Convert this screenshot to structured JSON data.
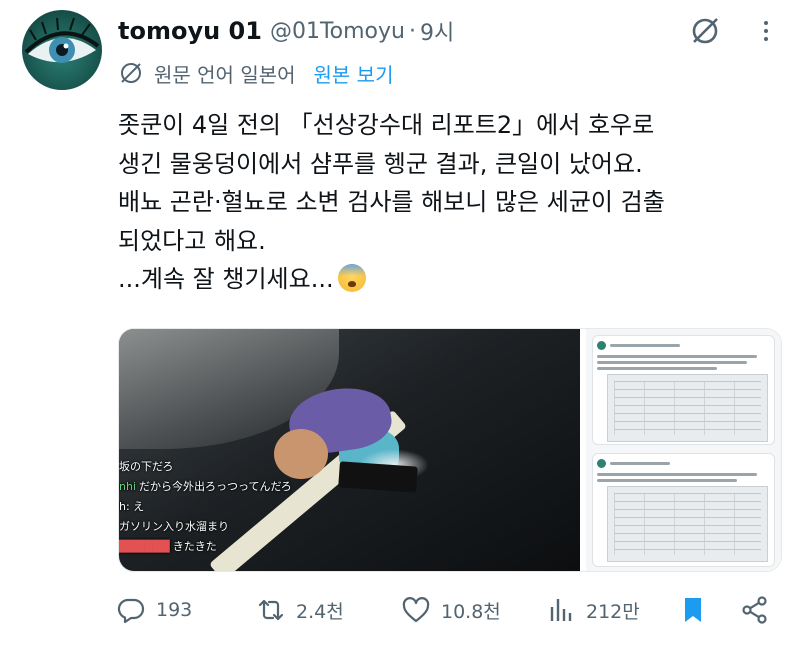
{
  "author": {
    "display_name": "tomoyu 01",
    "handle": "@01Tomoyu",
    "separator": "·",
    "time": "9시"
  },
  "translation": {
    "language_label": "원문 언어 일본어",
    "show_original_label": "원본 보기"
  },
  "tweet": {
    "lines": [
      "좃쿤이 4일 전의 「선상강수대 리포트2」에서 호우로",
      "생긴 물웅덩이에서 샴푸를 헹군 결과, 큰일이 났어요.",
      "배뇨 곤란·혈뇨로 소변 검사를 해보니 많은 세균이 검출",
      "되었다고 해요.",
      "...계속 잘 챙기세요..."
    ]
  },
  "media": {
    "chat_lines": [
      {
        "user": "",
        "text": "坂の下だろ"
      },
      {
        "user": "nhi",
        "text": "だから今外出ろっつってんだろ"
      },
      {
        "user": "",
        "text": "h: え"
      },
      {
        "user": "",
        "text": "ガソリン入り水溜まり"
      },
      {
        "user": "",
        "text": ""
      },
      {
        "user": "",
        "text": "きたきた"
      }
    ]
  },
  "actions": {
    "reply_count": "193",
    "retweet_count": "2.4천",
    "like_count": "10.8천",
    "view_count": "212만"
  },
  "colors": {
    "accent": "#1d9bf0",
    "secondary_text": "#536471",
    "primary_text": "#0f1419"
  },
  "icons": [
    "grok-icon",
    "more-icon",
    "translate-icon",
    "reply-icon",
    "retweet-icon",
    "like-icon",
    "views-icon",
    "bookmark-icon",
    "share-icon"
  ]
}
